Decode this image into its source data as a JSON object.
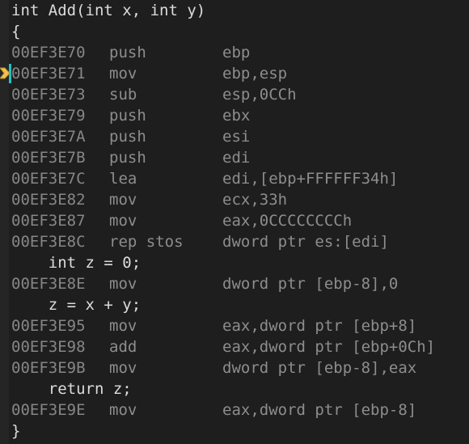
{
  "window": {
    "view_name": "disassembly-view",
    "theme": "dark",
    "background_color": "#1e1e1e",
    "gutter_color": "#252526"
  },
  "markers": {
    "instruction_pointer_arrow": {
      "icon": "yellow-right-arrow-icon",
      "color": "#f2c14e",
      "line_index": 3
    },
    "current_statement_bar": {
      "icon": "cyan-vertical-bar",
      "color": "#22c1c3",
      "line_index": 3
    }
  },
  "colors": {
    "source_text": "#dcdcdc",
    "address_text": "#868686",
    "mnemonic_text": "#8d8d8d",
    "operand_text": "#8d8d8d"
  },
  "lines": [
    {
      "kind": "src",
      "text": "int Add(int x, int y)"
    },
    {
      "kind": "src",
      "text": "{"
    },
    {
      "kind": "asm",
      "address": "00EF3E70",
      "mnemonic": "push",
      "operands": "ebp"
    },
    {
      "kind": "asm",
      "address": "00EF3E71",
      "mnemonic": "mov",
      "operands": "ebp,esp"
    },
    {
      "kind": "asm",
      "address": "00EF3E73",
      "mnemonic": "sub",
      "operands": "esp,0CCh"
    },
    {
      "kind": "asm",
      "address": "00EF3E79",
      "mnemonic": "push",
      "operands": "ebx"
    },
    {
      "kind": "asm",
      "address": "00EF3E7A",
      "mnemonic": "push",
      "operands": "esi"
    },
    {
      "kind": "asm",
      "address": "00EF3E7B",
      "mnemonic": "push",
      "operands": "edi"
    },
    {
      "kind": "asm",
      "address": "00EF3E7C",
      "mnemonic": "lea",
      "operands": "edi,[ebp+FFFFFF34h]"
    },
    {
      "kind": "asm",
      "address": "00EF3E82",
      "mnemonic": "mov",
      "operands": "ecx,33h"
    },
    {
      "kind": "asm",
      "address": "00EF3E87",
      "mnemonic": "mov",
      "operands": "eax,0CCCCCCCCh"
    },
    {
      "kind": "asm",
      "address": "00EF3E8C",
      "mnemonic": "rep stos",
      "operands": "dword ptr es:[edi]"
    },
    {
      "kind": "src",
      "text": "    int z = 0;"
    },
    {
      "kind": "asm",
      "address": "00EF3E8E",
      "mnemonic": "mov",
      "operands": "dword ptr [ebp-8],0"
    },
    {
      "kind": "src",
      "text": "    z = x + y;"
    },
    {
      "kind": "asm",
      "address": "00EF3E95",
      "mnemonic": "mov",
      "operands": "eax,dword ptr [ebp+8]"
    },
    {
      "kind": "asm",
      "address": "00EF3E98",
      "mnemonic": "add",
      "operands": "eax,dword ptr [ebp+0Ch]"
    },
    {
      "kind": "asm",
      "address": "00EF3E9B",
      "mnemonic": "mov",
      "operands": "dword ptr [ebp-8],eax"
    },
    {
      "kind": "src",
      "text": "    return z;"
    },
    {
      "kind": "asm",
      "address": "00EF3E9E",
      "mnemonic": "mov",
      "operands": "eax,dword ptr [ebp-8]"
    },
    {
      "kind": "src",
      "text": "}"
    }
  ]
}
